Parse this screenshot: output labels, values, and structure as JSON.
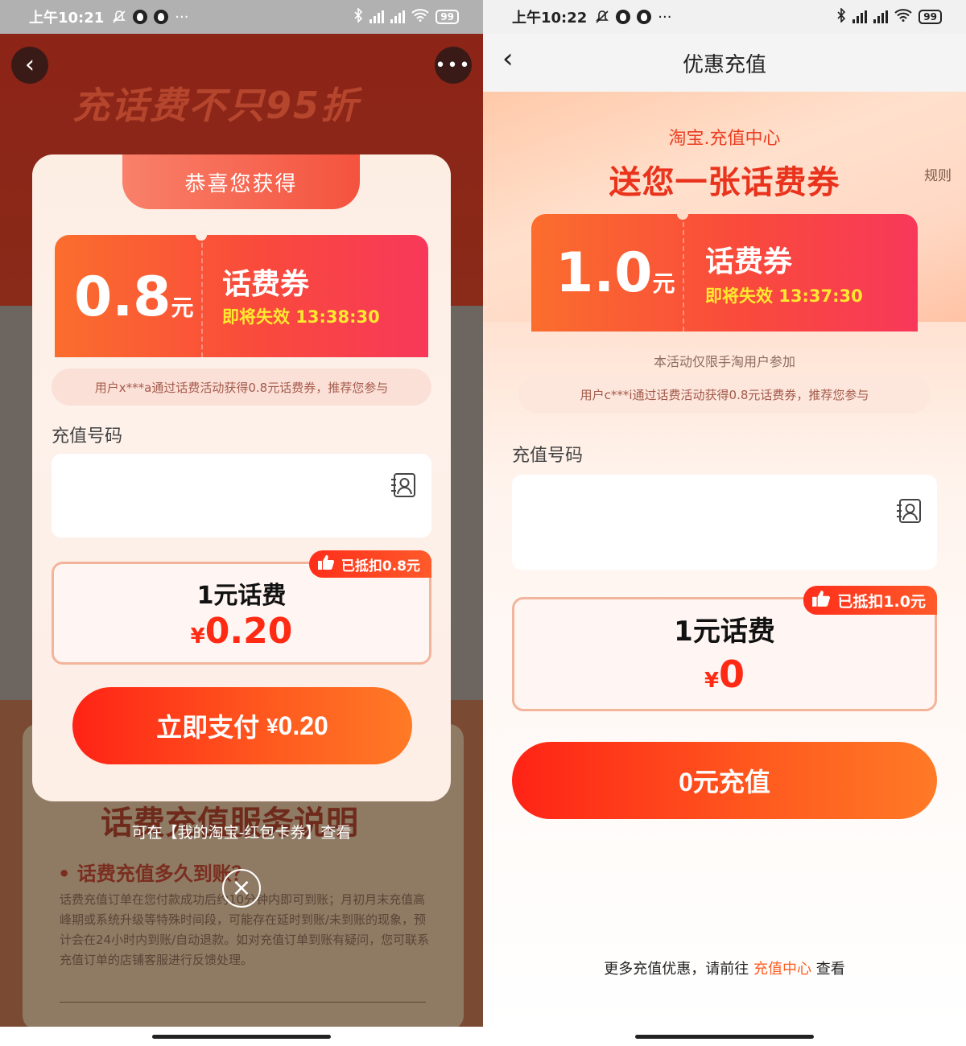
{
  "left": {
    "status": {
      "time": "上午10:21",
      "battery": "99",
      "hd": "HD"
    },
    "bg": {
      "headline": "充话费不只95折",
      "info_title": "话费充值服务说明",
      "question": "• 话费充值多久到账？",
      "answer": "话费充值订单在您付款成功后约10分钟内即可到账；月初月末充值高峰期或系统升级等特殊时间段，可能存在延时到账/未到账的现象，预计会在24小时内到账/自动退款。如对充值订单到账有疑问，您可联系充值订单的店铺客服进行反馈处理。"
    },
    "modal": {
      "tab_title": "恭喜您获得",
      "coupon_amount": "0.8",
      "coupon_unit": "元",
      "coupon_type": "话费券",
      "coupon_expire": "即将失效 13:38:30",
      "notice": "用户x***a通过话费活动获得0.8元话费券，推荐您参与",
      "phone_label": "充值号码",
      "phone_value": "",
      "product_name": "1元话费",
      "price_symbol": "¥",
      "price_value": "0.20",
      "discount_tag": "已抵扣0.8元",
      "pay_label": "立即支付",
      "pay_symbol": "¥",
      "pay_value": "0.20"
    },
    "footer_note": "可在【我的淘宝-红包卡券】查看",
    "close_icon": "close-icon"
  },
  "right": {
    "status": {
      "time": "上午10:22",
      "battery": "99",
      "hd": "HD"
    },
    "nav_title": "优惠充值",
    "hero_sub": "淘宝.充值中心",
    "hero_title": "送您一张话费券",
    "rules": "规则",
    "coupon_amount": "1.0",
    "coupon_unit": "元",
    "coupon_type": "话费券",
    "coupon_expire": "即将失效 13:37:30",
    "limit_note": "本活动仅限手淘用户参加",
    "notice": "用户c***i通过话费活动获得0.8元话费券，推荐您参与",
    "phone_label": "充值号码",
    "phone_value": "",
    "product_name": "1元话费",
    "price_symbol": "¥",
    "price_value": "0",
    "discount_tag": "已抵扣1.0元",
    "recharge_label": "0元充值",
    "more_prefix": "更多充值优惠，请前往",
    "more_link": "充值中心",
    "more_suffix": "查看"
  },
  "colors": {
    "accent": "#ff3b1f",
    "expire_yellow": "#ffe930",
    "price_red": "#ff2a14"
  }
}
